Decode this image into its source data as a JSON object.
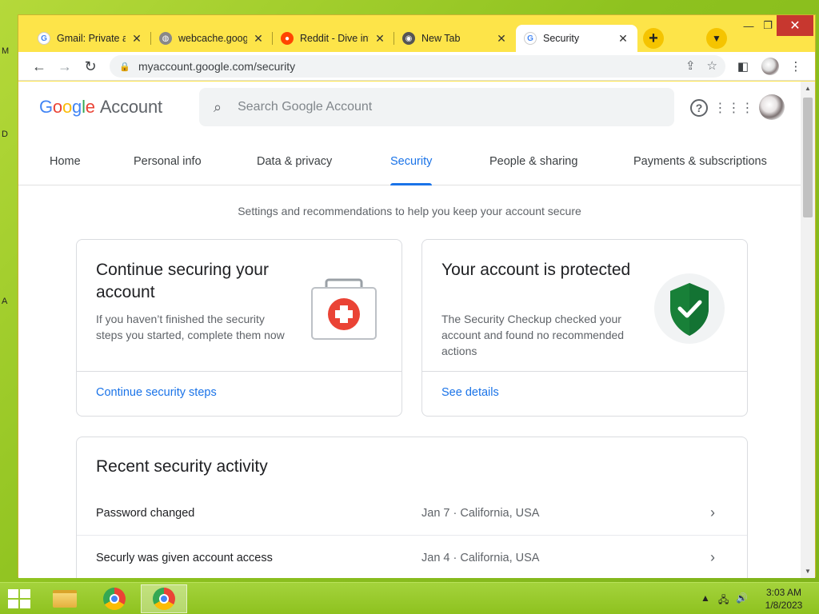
{
  "desktop": {
    "edge_letters": [
      "M",
      "D",
      "A"
    ]
  },
  "browser": {
    "tabs": [
      {
        "title": "Gmail: Private an",
        "icon": "google-g-icon"
      },
      {
        "title": "webcache.googl",
        "icon": "globe-icon"
      },
      {
        "title": "Reddit - Dive int",
        "icon": "reddit-icon"
      },
      {
        "title": "New Tab",
        "icon": "chrome-icon"
      },
      {
        "title": "Security",
        "icon": "google-g-icon",
        "active": true
      }
    ],
    "url": "myaccount.google.com/security"
  },
  "account": {
    "logo_google": [
      "G",
      "o",
      "o",
      "g",
      "l",
      "e"
    ],
    "logo_account": "Account",
    "search_placeholder": "Search Google Account",
    "nav": [
      "Home",
      "Personal info",
      "Data & privacy",
      "Security",
      "People & sharing",
      "Payments & subscriptions"
    ],
    "active_nav": "Security",
    "intro": "Settings and recommendations to help you keep your account secure",
    "card_continue": {
      "title": "Continue securing your account",
      "desc": "If you haven’t finished the security steps you started, complete them now",
      "link": "Continue security steps"
    },
    "card_protected": {
      "title": "Your account is protected",
      "desc": "The Security Checkup checked your account and found no recommended actions",
      "link": "See details"
    },
    "activity": {
      "title": "Recent security activity",
      "rows": [
        {
          "event": "Password changed",
          "meta": "Jan 7 · California, USA"
        },
        {
          "event": "Securly was given account access",
          "meta": "Jan 4 · California, USA"
        }
      ]
    }
  },
  "taskbar": {
    "time": "3:03 AM",
    "date": "1/8/2023"
  },
  "colors": {
    "accent": "#1a73e8",
    "tabstrip": "#fde449",
    "shield": "#188038",
    "kit_red": "#ea4335"
  }
}
